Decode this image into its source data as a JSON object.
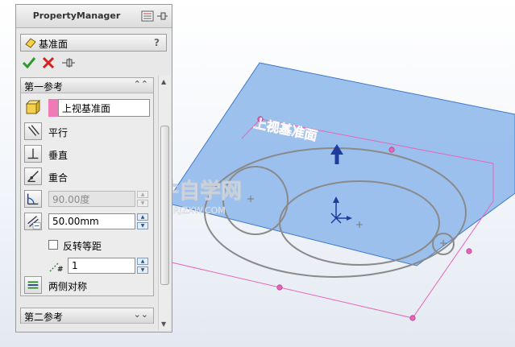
{
  "panel": {
    "title": "PropertyManager",
    "feature_name": "基准面",
    "help_label": "?"
  },
  "first_reference": {
    "title": "第一参考",
    "selected_entity": "上视基准面",
    "options": {
      "parallel": "平行",
      "perpendicular": "垂直",
      "coincident": "重合"
    },
    "angle_value": "90.00度",
    "offset_value": "50.00mm",
    "flip_offset_label": "反转等距",
    "instance_count": "1",
    "mid_plane_label": "两侧对称"
  },
  "second_reference": {
    "title": "第二参考"
  },
  "viewport": {
    "plane_label": "上视基准面",
    "watermark_main": "软件自学网",
    "watermark_sub": "WWW.RJZXW.COM"
  },
  "colors": {
    "plane_fill": "#8fb8ea",
    "plane_border": "#3f78c8",
    "preview_pink": "#e766b8",
    "sketch_gray": "#8a8a8a",
    "accept_green": "#2d9a2d",
    "cancel_red": "#d42020"
  }
}
